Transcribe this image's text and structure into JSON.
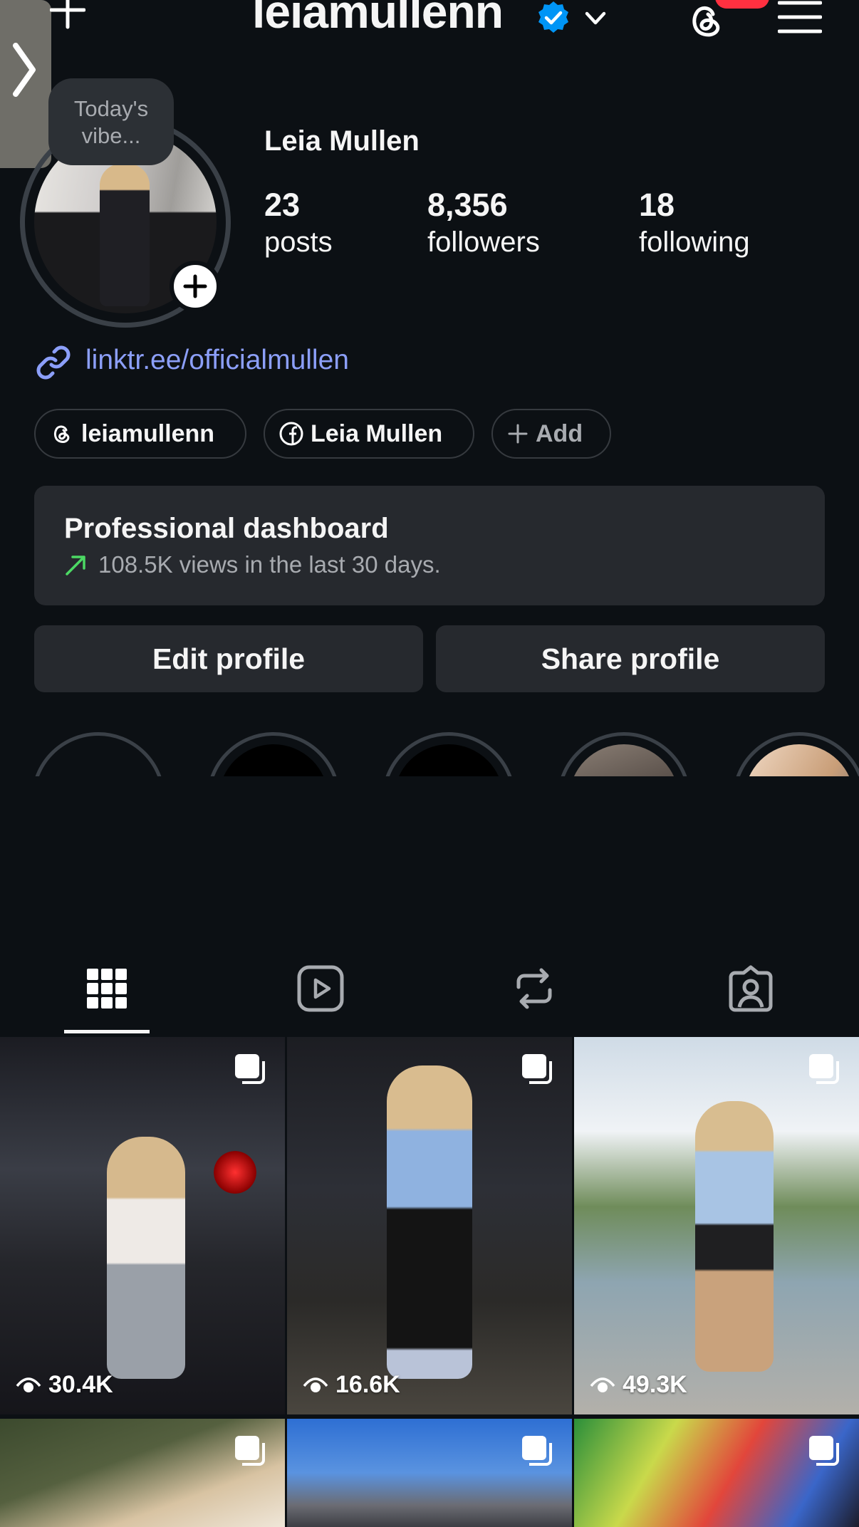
{
  "header": {
    "username": "leiamullenn"
  },
  "note": {
    "text": "Today's vibe..."
  },
  "profile": {
    "display_name": "Leia Mullen",
    "stats": [
      {
        "value": "23",
        "label": "posts"
      },
      {
        "value": "8,356",
        "label": "followers"
      },
      {
        "value": "18",
        "label": "following"
      }
    ],
    "link": "linktr.ee/officialmullen"
  },
  "chips": [
    {
      "label": "leiamullenn",
      "icon": "threads-icon"
    },
    {
      "label": "Leia Mullen",
      "icon": "facebook-icon"
    },
    {
      "label": "Add",
      "icon": "plus-icon"
    }
  ],
  "dashboard": {
    "title": "Professional dashboard",
    "subtitle": "108.5K views in the last 30 days."
  },
  "buttons": {
    "edit": "Edit profile",
    "share": "Share profile"
  },
  "tabs": [
    "grid-icon",
    "reels-icon",
    "reposts-icon",
    "tagged-icon"
  ],
  "grid": {
    "posts": [
      {
        "views": "30.4K"
      },
      {
        "views": "16.6K"
      },
      {
        "views": "49.3K"
      },
      {
        "views": ""
      },
      {
        "views": ""
      },
      {
        "views": ""
      }
    ]
  },
  "colors": {
    "background": "#0c1014",
    "link": "#8c9ff9",
    "verified": "#0095f6",
    "badge": "#ff3040",
    "card": "#26292e"
  }
}
